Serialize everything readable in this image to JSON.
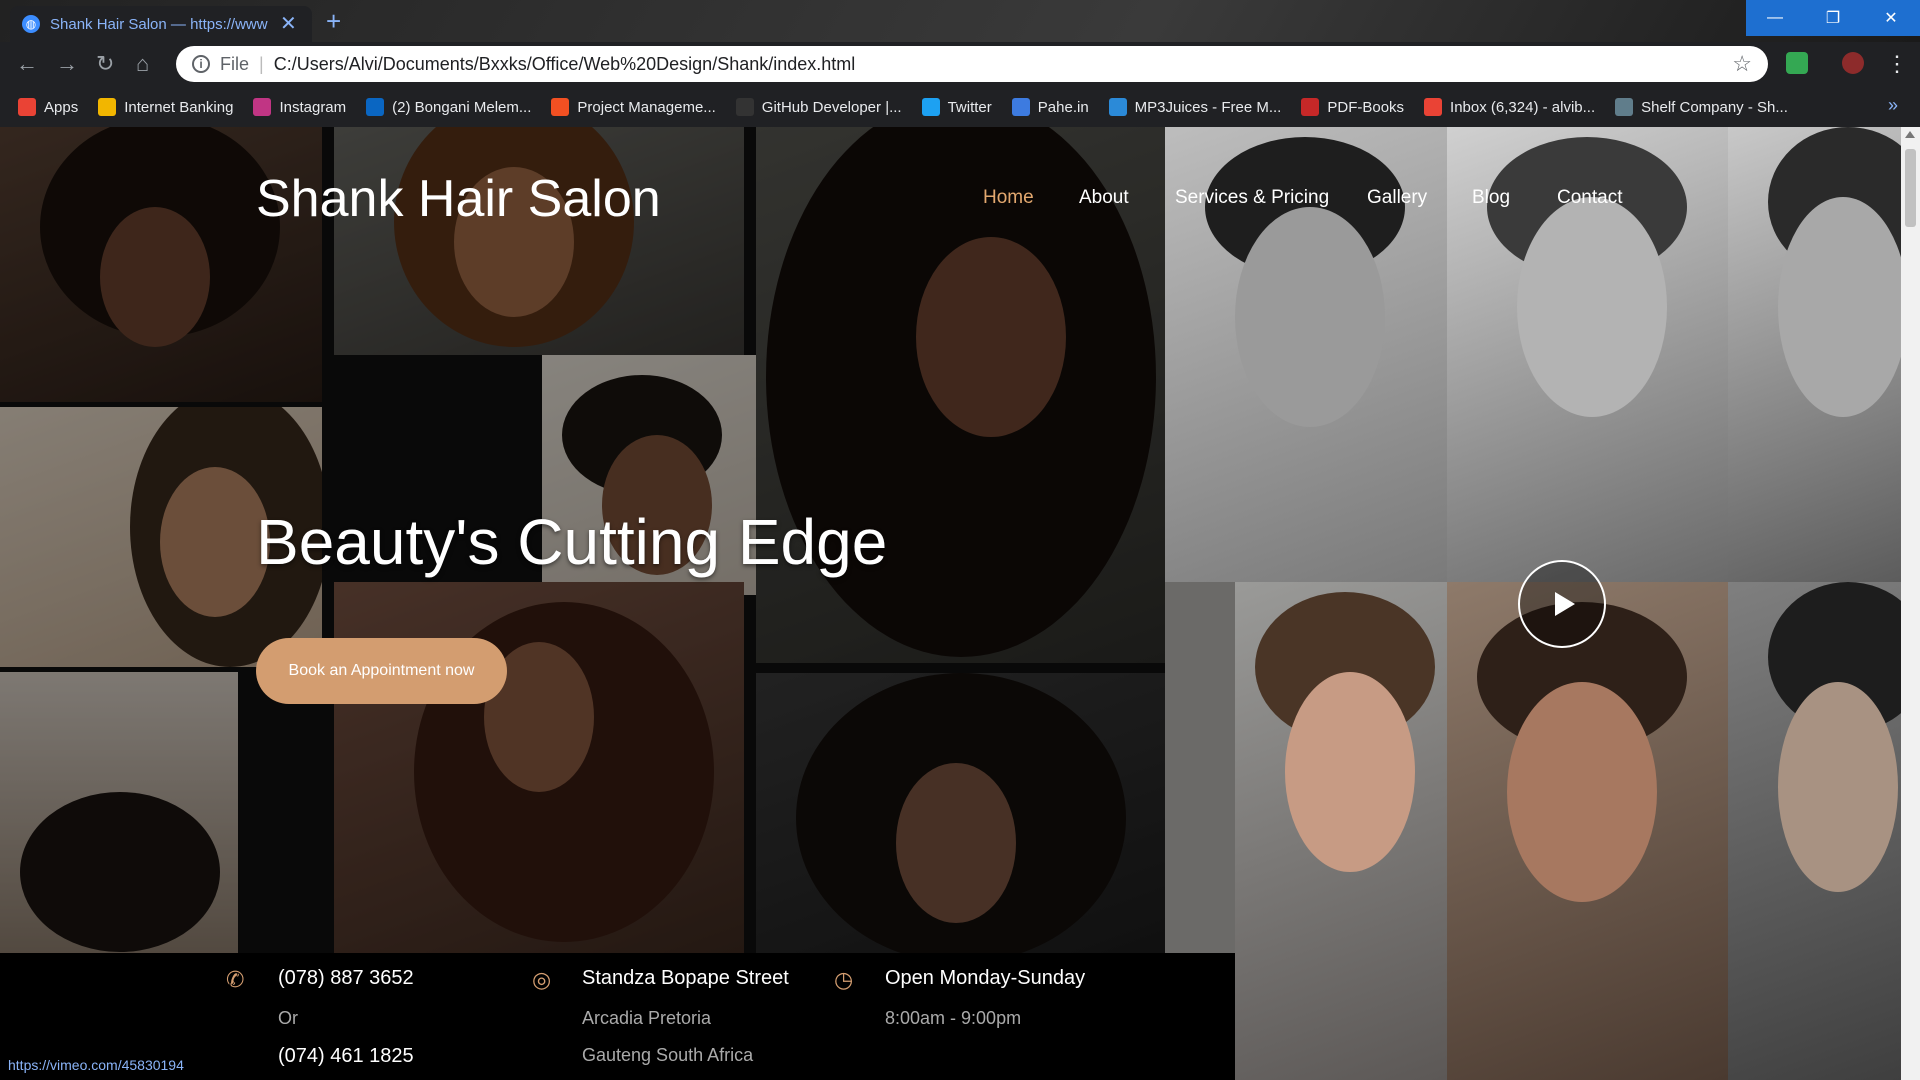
{
  "browser": {
    "tab_title": "Shank Hair Salon — https://www",
    "tab_close": "✕",
    "new_tab": "+",
    "scheme_label": "File",
    "url": "C:/Users/Alvi/Documents/Bxxks/Office/Web%20Design/Shank/index.html",
    "window_controls": {
      "minimize": "—",
      "maximize": "❐",
      "close": "✕"
    },
    "status_url": "https://vimeo.com/45830194"
  },
  "bookmarks": [
    {
      "label": "Apps",
      "icon": "apps-grid-icon",
      "color": "#ea4335"
    },
    {
      "label": "Internet Banking",
      "icon": "bank-icon",
      "color": "#f2b600"
    },
    {
      "label": "Instagram",
      "icon": "instagram-icon",
      "color": "#c13584"
    },
    {
      "label": "(2) Bongani Melem...",
      "icon": "linkedin-icon",
      "color": "#0a66c2"
    },
    {
      "label": "Project Manageme...",
      "icon": "microsoft-icon",
      "color": "#f25022"
    },
    {
      "label": "GitHub Developer |...",
      "icon": "github-icon",
      "color": "#333333"
    },
    {
      "label": "Twitter",
      "icon": "twitter-icon",
      "color": "#1da1f2"
    },
    {
      "label": "Pahe.in",
      "icon": "pahe-icon",
      "color": "#3d7be0"
    },
    {
      "label": "MP3Juices - Free M...",
      "icon": "download-icon",
      "color": "#2b8ad8"
    },
    {
      "label": "PDF-Books",
      "icon": "pdf-icon",
      "color": "#c62828"
    },
    {
      "label": "Inbox (6,324) - alvib...",
      "icon": "gmail-icon",
      "color": "#ea4335"
    },
    {
      "label": "Shelf Company - Sh...",
      "icon": "shelf-icon",
      "color": "#607d8b"
    }
  ],
  "site": {
    "brand": "Shank Hair Salon",
    "nav": [
      {
        "label": "Home",
        "active": true
      },
      {
        "label": "About",
        "active": false
      },
      {
        "label": "Services & Pricing",
        "active": false
      },
      {
        "label": "Gallery",
        "active": false
      },
      {
        "label": "Blog",
        "active": false
      },
      {
        "label": "Contact",
        "active": false
      }
    ],
    "headline": "Beauty's Cutting Edge",
    "cta": "Book an Appointment now",
    "info": {
      "phone": {
        "icon": "phone-icon",
        "main": "(078) 887 3652",
        "line2": "Or",
        "line3": "(074) 461 1825"
      },
      "address": {
        "icon": "location-icon",
        "main": "Standza Bopape Street",
        "line2": "Arcadia Pretoria",
        "line3": "Gauteng South Africa"
      },
      "hours": {
        "icon": "clock-icon",
        "main": "Open Monday-Sunday",
        "line2": "8:00am - 9:00pm"
      }
    }
  },
  "colors": {
    "accent": "#d39d70",
    "active_nav": "#e3a86f",
    "chrome_dark": "#202124",
    "window_control_blue": "#1e6fd0"
  }
}
